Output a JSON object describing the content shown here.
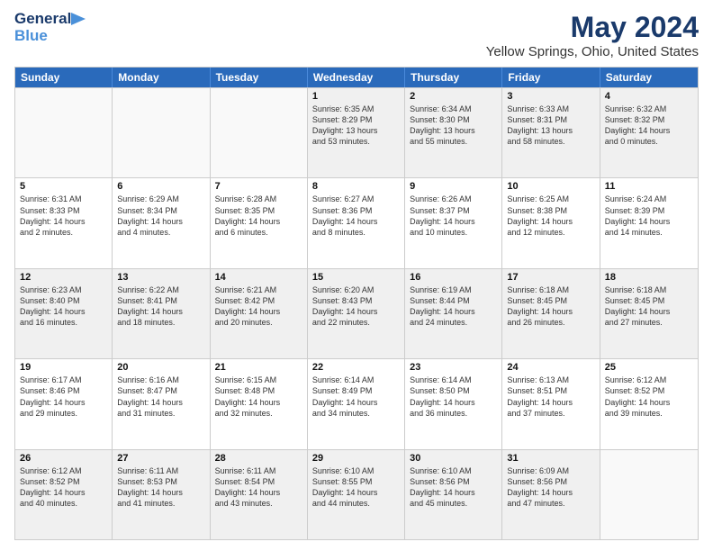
{
  "logo": {
    "line1": "General",
    "line2": "Blue"
  },
  "title": "May 2024",
  "subtitle": "Yellow Springs, Ohio, United States",
  "header_days": [
    "Sunday",
    "Monday",
    "Tuesday",
    "Wednesday",
    "Thursday",
    "Friday",
    "Saturday"
  ],
  "rows": [
    [
      {
        "day": "",
        "info": ""
      },
      {
        "day": "",
        "info": ""
      },
      {
        "day": "",
        "info": ""
      },
      {
        "day": "1",
        "info": "Sunrise: 6:35 AM\nSunset: 8:29 PM\nDaylight: 13 hours\nand 53 minutes."
      },
      {
        "day": "2",
        "info": "Sunrise: 6:34 AM\nSunset: 8:30 PM\nDaylight: 13 hours\nand 55 minutes."
      },
      {
        "day": "3",
        "info": "Sunrise: 6:33 AM\nSunset: 8:31 PM\nDaylight: 13 hours\nand 58 minutes."
      },
      {
        "day": "4",
        "info": "Sunrise: 6:32 AM\nSunset: 8:32 PM\nDaylight: 14 hours\nand 0 minutes."
      }
    ],
    [
      {
        "day": "5",
        "info": "Sunrise: 6:31 AM\nSunset: 8:33 PM\nDaylight: 14 hours\nand 2 minutes."
      },
      {
        "day": "6",
        "info": "Sunrise: 6:29 AM\nSunset: 8:34 PM\nDaylight: 14 hours\nand 4 minutes."
      },
      {
        "day": "7",
        "info": "Sunrise: 6:28 AM\nSunset: 8:35 PM\nDaylight: 14 hours\nand 6 minutes."
      },
      {
        "day": "8",
        "info": "Sunrise: 6:27 AM\nSunset: 8:36 PM\nDaylight: 14 hours\nand 8 minutes."
      },
      {
        "day": "9",
        "info": "Sunrise: 6:26 AM\nSunset: 8:37 PM\nDaylight: 14 hours\nand 10 minutes."
      },
      {
        "day": "10",
        "info": "Sunrise: 6:25 AM\nSunset: 8:38 PM\nDaylight: 14 hours\nand 12 minutes."
      },
      {
        "day": "11",
        "info": "Sunrise: 6:24 AM\nSunset: 8:39 PM\nDaylight: 14 hours\nand 14 minutes."
      }
    ],
    [
      {
        "day": "12",
        "info": "Sunrise: 6:23 AM\nSunset: 8:40 PM\nDaylight: 14 hours\nand 16 minutes."
      },
      {
        "day": "13",
        "info": "Sunrise: 6:22 AM\nSunset: 8:41 PM\nDaylight: 14 hours\nand 18 minutes."
      },
      {
        "day": "14",
        "info": "Sunrise: 6:21 AM\nSunset: 8:42 PM\nDaylight: 14 hours\nand 20 minutes."
      },
      {
        "day": "15",
        "info": "Sunrise: 6:20 AM\nSunset: 8:43 PM\nDaylight: 14 hours\nand 22 minutes."
      },
      {
        "day": "16",
        "info": "Sunrise: 6:19 AM\nSunset: 8:44 PM\nDaylight: 14 hours\nand 24 minutes."
      },
      {
        "day": "17",
        "info": "Sunrise: 6:18 AM\nSunset: 8:45 PM\nDaylight: 14 hours\nand 26 minutes."
      },
      {
        "day": "18",
        "info": "Sunrise: 6:18 AM\nSunset: 8:45 PM\nDaylight: 14 hours\nand 27 minutes."
      }
    ],
    [
      {
        "day": "19",
        "info": "Sunrise: 6:17 AM\nSunset: 8:46 PM\nDaylight: 14 hours\nand 29 minutes."
      },
      {
        "day": "20",
        "info": "Sunrise: 6:16 AM\nSunset: 8:47 PM\nDaylight: 14 hours\nand 31 minutes."
      },
      {
        "day": "21",
        "info": "Sunrise: 6:15 AM\nSunset: 8:48 PM\nDaylight: 14 hours\nand 32 minutes."
      },
      {
        "day": "22",
        "info": "Sunrise: 6:14 AM\nSunset: 8:49 PM\nDaylight: 14 hours\nand 34 minutes."
      },
      {
        "day": "23",
        "info": "Sunrise: 6:14 AM\nSunset: 8:50 PM\nDaylight: 14 hours\nand 36 minutes."
      },
      {
        "day": "24",
        "info": "Sunrise: 6:13 AM\nSunset: 8:51 PM\nDaylight: 14 hours\nand 37 minutes."
      },
      {
        "day": "25",
        "info": "Sunrise: 6:12 AM\nSunset: 8:52 PM\nDaylight: 14 hours\nand 39 minutes."
      }
    ],
    [
      {
        "day": "26",
        "info": "Sunrise: 6:12 AM\nSunset: 8:52 PM\nDaylight: 14 hours\nand 40 minutes."
      },
      {
        "day": "27",
        "info": "Sunrise: 6:11 AM\nSunset: 8:53 PM\nDaylight: 14 hours\nand 41 minutes."
      },
      {
        "day": "28",
        "info": "Sunrise: 6:11 AM\nSunset: 8:54 PM\nDaylight: 14 hours\nand 43 minutes."
      },
      {
        "day": "29",
        "info": "Sunrise: 6:10 AM\nSunset: 8:55 PM\nDaylight: 14 hours\nand 44 minutes."
      },
      {
        "day": "30",
        "info": "Sunrise: 6:10 AM\nSunset: 8:56 PM\nDaylight: 14 hours\nand 45 minutes."
      },
      {
        "day": "31",
        "info": "Sunrise: 6:09 AM\nSunset: 8:56 PM\nDaylight: 14 hours\nand 47 minutes."
      },
      {
        "day": "",
        "info": ""
      }
    ]
  ],
  "shaded_rows": [
    0,
    2,
    4
  ],
  "colors": {
    "header_bg": "#2a6abb",
    "header_text": "#ffffff",
    "title_color": "#1a3a6b",
    "border": "#cccccc",
    "shaded_cell": "#f0f0f0",
    "empty_cell": "#f9f9f9"
  }
}
